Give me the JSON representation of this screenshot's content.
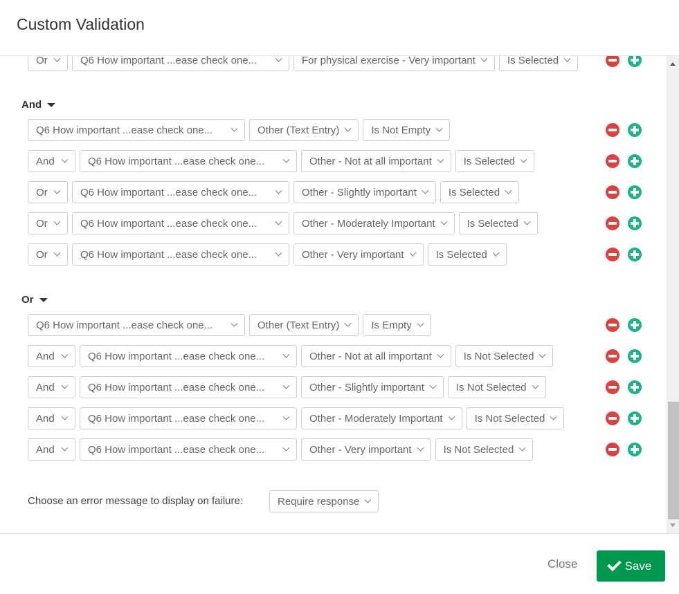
{
  "title": "Custom Validation",
  "colors": {
    "remove": "#d9423e",
    "add": "#1bb38b",
    "save": "#00984f"
  },
  "top_row": {
    "conj": "Or",
    "question": "Q6 How important ...ease check one...",
    "choice": "For physical exercise - Very important",
    "op": "Is Selected"
  },
  "groups": [
    {
      "label": "And",
      "rows": [
        {
          "conj": "",
          "question": "Q6 How important ...ease check one...",
          "choice": "Other (Text Entry)",
          "op": "Is Not Empty"
        },
        {
          "conj": "And",
          "question": "Q6 How important ...ease check one...",
          "choice": "Other - Not at all important",
          "op": "Is Selected"
        },
        {
          "conj": "Or",
          "question": "Q6 How important ...ease check one...",
          "choice": "Other - Slightly important",
          "op": "Is Selected"
        },
        {
          "conj": "Or",
          "question": "Q6 How important ...ease check one...",
          "choice": "Other - Moderately Important",
          "op": "Is Selected"
        },
        {
          "conj": "Or",
          "question": "Q6 How important ...ease check one...",
          "choice": "Other - Very important",
          "op": "Is Selected"
        }
      ]
    },
    {
      "label": "Or",
      "rows": [
        {
          "conj": "",
          "question": "Q6 How important ...ease check one...",
          "choice": "Other (Text Entry)",
          "op": "Is Empty"
        },
        {
          "conj": "And",
          "question": "Q6 How important ...ease check one...",
          "choice": "Other - Not at all important",
          "op": "Is Not Selected"
        },
        {
          "conj": "And",
          "question": "Q6 How important ...ease check one...",
          "choice": "Other - Slightly important",
          "op": "Is Not Selected"
        },
        {
          "conj": "And",
          "question": "Q6 How important ...ease check one...",
          "choice": "Other - Moderately Important",
          "op": "Is Not Selected"
        },
        {
          "conj": "And",
          "question": "Q6 How important ...ease check one...",
          "choice": "Other - Very important",
          "op": "Is Not Selected"
        }
      ]
    }
  ],
  "error": {
    "label": "Choose an error message to display on failure:",
    "value": "Require response"
  },
  "footer": {
    "close": "Close",
    "save": "Save"
  }
}
